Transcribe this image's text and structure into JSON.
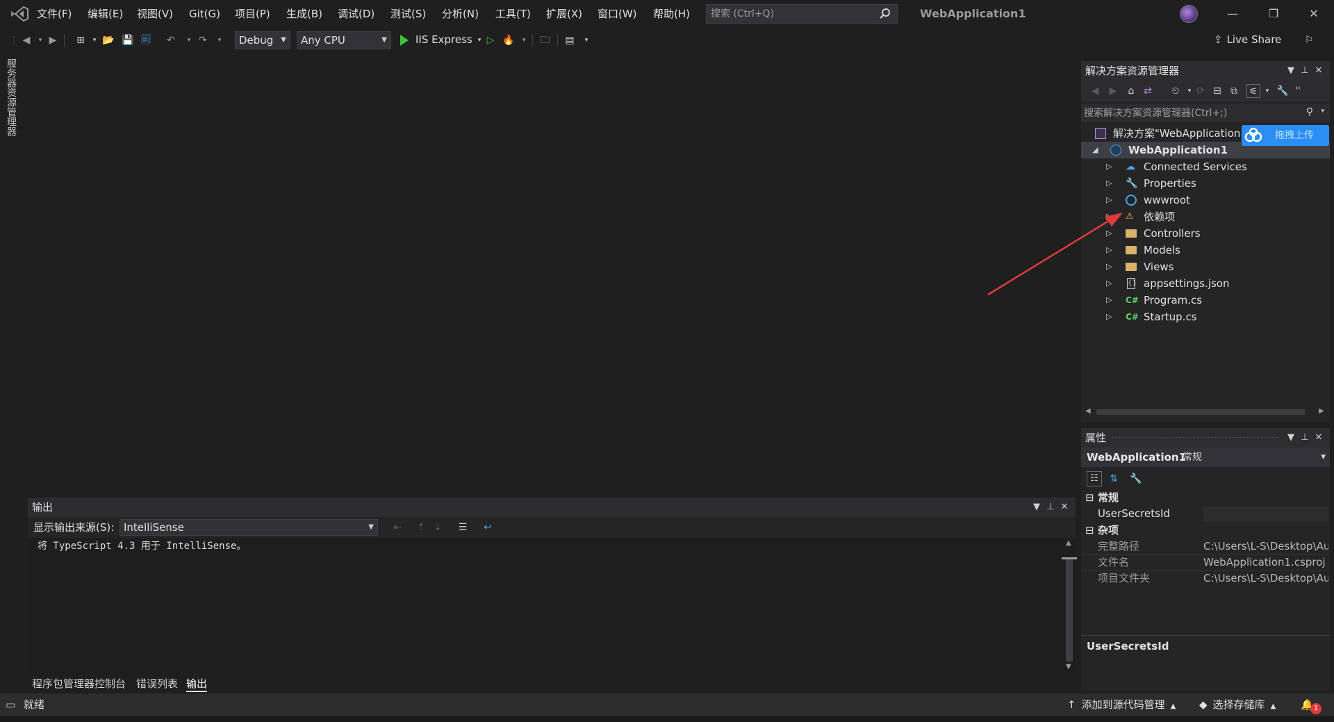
{
  "window": {
    "title": "WebApplication1",
    "menu": [
      "文件(F)",
      "编辑(E)",
      "视图(V)",
      "Git(G)",
      "项目(P)",
      "生成(B)",
      "调试(D)",
      "测试(S)",
      "分析(N)",
      "工具(T)",
      "扩展(X)",
      "窗口(W)",
      "帮助(H)"
    ],
    "search_placeholder": "搜索 (Ctrl+Q)"
  },
  "toolbar": {
    "config": "Debug",
    "platform": "Any CPU",
    "run_target": "IIS Express",
    "live_share": "Live Share"
  },
  "left_tab": {
    "label": "服务器资源管理器"
  },
  "solution_explorer": {
    "title": "解决方案资源管理器",
    "search_placeholder": "搜索解决方案资源管理器(Ctrl+;)",
    "solution_label": "解决方案\"WebApplication",
    "project_label": "WebApplication1",
    "items": [
      {
        "label": "Connected Services",
        "icon": "connected-services-icon"
      },
      {
        "label": "Properties",
        "icon": "properties-icon"
      },
      {
        "label": "wwwroot",
        "icon": "globe-icon"
      },
      {
        "label": "依赖项",
        "icon": "dependencies-warning-icon"
      },
      {
        "label": "Controllers",
        "icon": "folder-icon"
      },
      {
        "label": "Models",
        "icon": "folder-icon"
      },
      {
        "label": "Views",
        "icon": "folder-icon"
      },
      {
        "label": "appsettings.json",
        "icon": "json-file-icon"
      },
      {
        "label": "Program.cs",
        "icon": "csharp-file-icon"
      },
      {
        "label": "Startup.cs",
        "icon": "csharp-file-icon"
      }
    ],
    "upload_button": "拖拽上传"
  },
  "properties": {
    "title": "属性",
    "object_name": "WebApplication1",
    "object_type": "常规",
    "categories": [
      {
        "name": "常规",
        "rows": [
          {
            "name": "UserSecretsId",
            "value": ""
          }
        ]
      },
      {
        "name": "杂项",
        "rows": [
          {
            "name": "完整路径",
            "value": "C:\\Users\\L-S\\Desktop\\Au"
          },
          {
            "name": "文件名",
            "value": "WebApplication1.csproj"
          },
          {
            "name": "项目文件夹",
            "value": "C:\\Users\\L-S\\Desktop\\Au"
          }
        ]
      }
    ],
    "description_title": "UserSecretsId"
  },
  "output": {
    "title": "输出",
    "source_label": "显示输出来源(S):",
    "source_value": "IntelliSense",
    "text": "将 TypeScript 4.3 用于 IntelliSense。"
  },
  "bottom_tabs": [
    "程序包管理器控制台",
    "错误列表",
    "输出"
  ],
  "statusbar": {
    "ready": "就绪",
    "add_source_control": "添加到源代码管理",
    "select_repo": "选择存储库",
    "notification_count": "1"
  },
  "colors": {
    "accent": "#007acc",
    "annotation_arrow": "#e03a3a",
    "run_green": "#3fbf3f",
    "baidu_blue": "#2a8ef5"
  }
}
